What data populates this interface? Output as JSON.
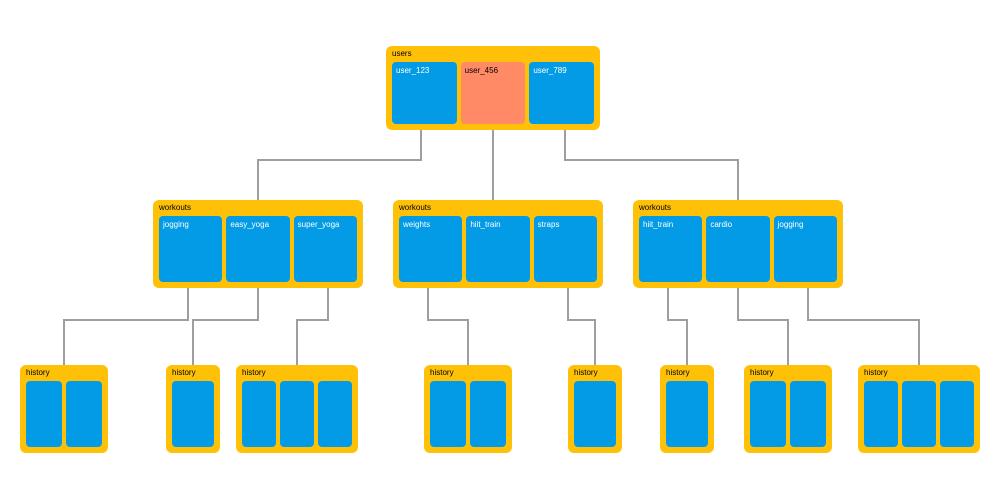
{
  "root": {
    "title": "users",
    "items": [
      {
        "label": "user_123",
        "highlight": false
      },
      {
        "label": "user_456",
        "highlight": true
      },
      {
        "label": "user_789",
        "highlight": false
      }
    ]
  },
  "workouts": [
    {
      "title": "workouts",
      "items": [
        {
          "label": "jogging"
        },
        {
          "label": "easy_yoga"
        },
        {
          "label": "super_yoga"
        }
      ]
    },
    {
      "title": "workouts",
      "items": [
        {
          "label": "weights"
        },
        {
          "label": "hiit_train"
        },
        {
          "label": "straps"
        }
      ]
    },
    {
      "title": "workouts",
      "items": [
        {
          "label": "hiit_train"
        },
        {
          "label": "cardio"
        },
        {
          "label": "jogging"
        }
      ]
    }
  ],
  "history": [
    {
      "title": "history",
      "count": 2
    },
    {
      "title": "history",
      "count": 1
    },
    {
      "title": "history",
      "count": 3
    },
    {
      "title": "history",
      "count": 2
    },
    {
      "title": "history",
      "count": 1
    },
    {
      "title": "history",
      "count": 1
    },
    {
      "title": "history",
      "count": 2
    },
    {
      "title": "history",
      "count": 3
    }
  ],
  "colors": {
    "container": "#ffc107",
    "item": "#039be5",
    "highlight": "#ff8a65",
    "connector": "#9e9e9e"
  }
}
